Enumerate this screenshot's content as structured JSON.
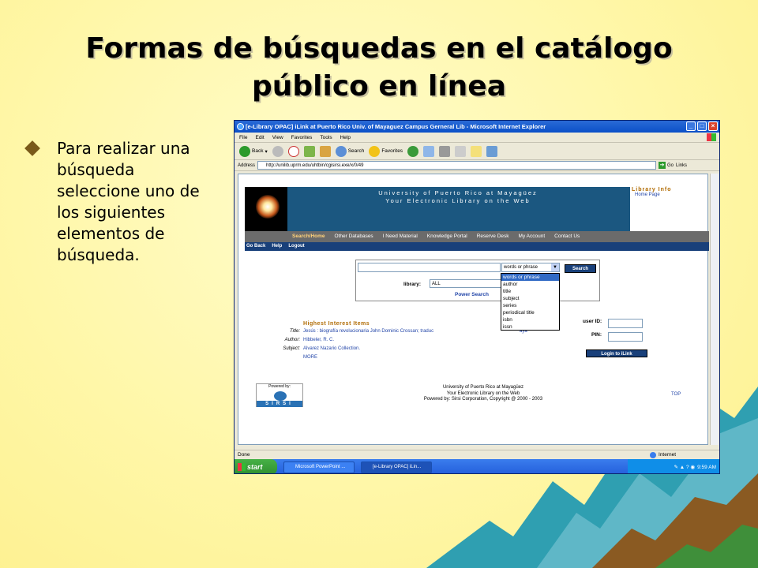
{
  "slide": {
    "title_line1": "Formas de búsquedas en el catálogo",
    "title_line2": "público en línea",
    "bullet": "Para realizar una búsqueda seleccione uno de los siguientes elementos de búsqueda."
  },
  "browser": {
    "window_title": "[e-Library OPAC] iLink at Puerto Rico Univ. of Mayaguez Campus Gerneral Lib - Microsoft Internet Explorer",
    "menu": [
      "File",
      "Edit",
      "View",
      "Favorites",
      "Tools",
      "Help"
    ],
    "toolbar": {
      "back": "Back",
      "search": "Search",
      "favorites": "Favorites"
    },
    "address_label": "Address",
    "address_url": "http://unilib.uprm.edu/uhtbin/cgisirsi.exe/x/0/49",
    "go_label": "Go",
    "links_label": "Links",
    "status_text": "Done",
    "status_zone": "Internet"
  },
  "opac": {
    "banner_line1": "University of Puerto Rico at Mayagüez",
    "banner_line2": "Your Electronic Library on the Web",
    "library_info_title": "Library Info",
    "library_info_link": "Home Page",
    "nav": [
      "Search/Home",
      "Other Databases",
      "I Need Material",
      "Knowledge Portal",
      "Reserve Desk",
      "My Account",
      "Contact Us"
    ],
    "subnav": [
      "Go Back",
      "Help",
      "Logout"
    ],
    "search_type_selected": "words or phrase",
    "search_button": "Search",
    "library_label": "library:",
    "library_value": "ALL",
    "power_search": "Power Search",
    "dropdown_options": [
      "words or phrase",
      "author",
      "title",
      "subject",
      "series",
      "periodical title",
      "isbn",
      "issn"
    ],
    "highest_title": "Highest Interest Items",
    "hi_title_label": "Title:",
    "hi_title_value": "Jesús : biografía revolucionaria John Dominic Crossan; traduc",
    "hi_title_tail": "aya",
    "hi_author_label": "Author:",
    "hi_author_value": "Hibbeler, R. C.",
    "hi_subject_label": "Subject:",
    "hi_subject_value": "Alvarez Nazario Collection.",
    "hi_more": "MORE",
    "user_id_label": "user ID:",
    "pin_label": "PIN:",
    "login_button": "Login to iLink",
    "sirsi_powered": "Powered by:",
    "sirsi_name": "SIRSI",
    "footer_line1": "University of Puerto Rico at Mayagüez",
    "footer_line2": "Your Electronic Library on the Web",
    "footer_line3": "Powered by: Sirsi Corporation, Copyright @ 2000 - 2003",
    "top_link": "TOP"
  },
  "taskbar": {
    "start": "start",
    "task1": "Microsoft PowerPoint ...",
    "task2": "[e-Library OPAC] iLin...",
    "clock": "9:59 AM"
  },
  "colors": {
    "banner": "#1b5780",
    "nav": "#6b6b6b",
    "subnav": "#19407a",
    "accent_orange": "#b06a00",
    "slide_bg": "#fff7a8"
  }
}
